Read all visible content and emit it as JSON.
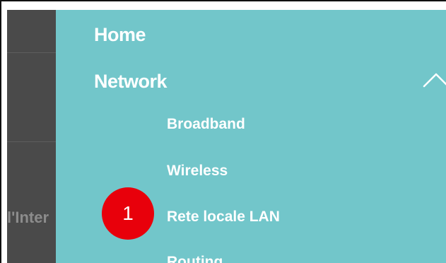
{
  "background": {
    "partial_text": "l'Inter"
  },
  "menu": {
    "items": [
      {
        "label": "Home"
      },
      {
        "label": "Network",
        "expanded": true,
        "icon": "chevron-up-icon"
      }
    ],
    "network_submenu": [
      {
        "label": "Broadband"
      },
      {
        "label": "Wireless"
      },
      {
        "label": "Rete locale LAN"
      },
      {
        "label": "Routing"
      }
    ]
  },
  "annotation": {
    "step_number": "1",
    "color": "#e8000b"
  },
  "colors": {
    "menu_background": "#72c6ca",
    "overlay": "#4a4a4a"
  }
}
